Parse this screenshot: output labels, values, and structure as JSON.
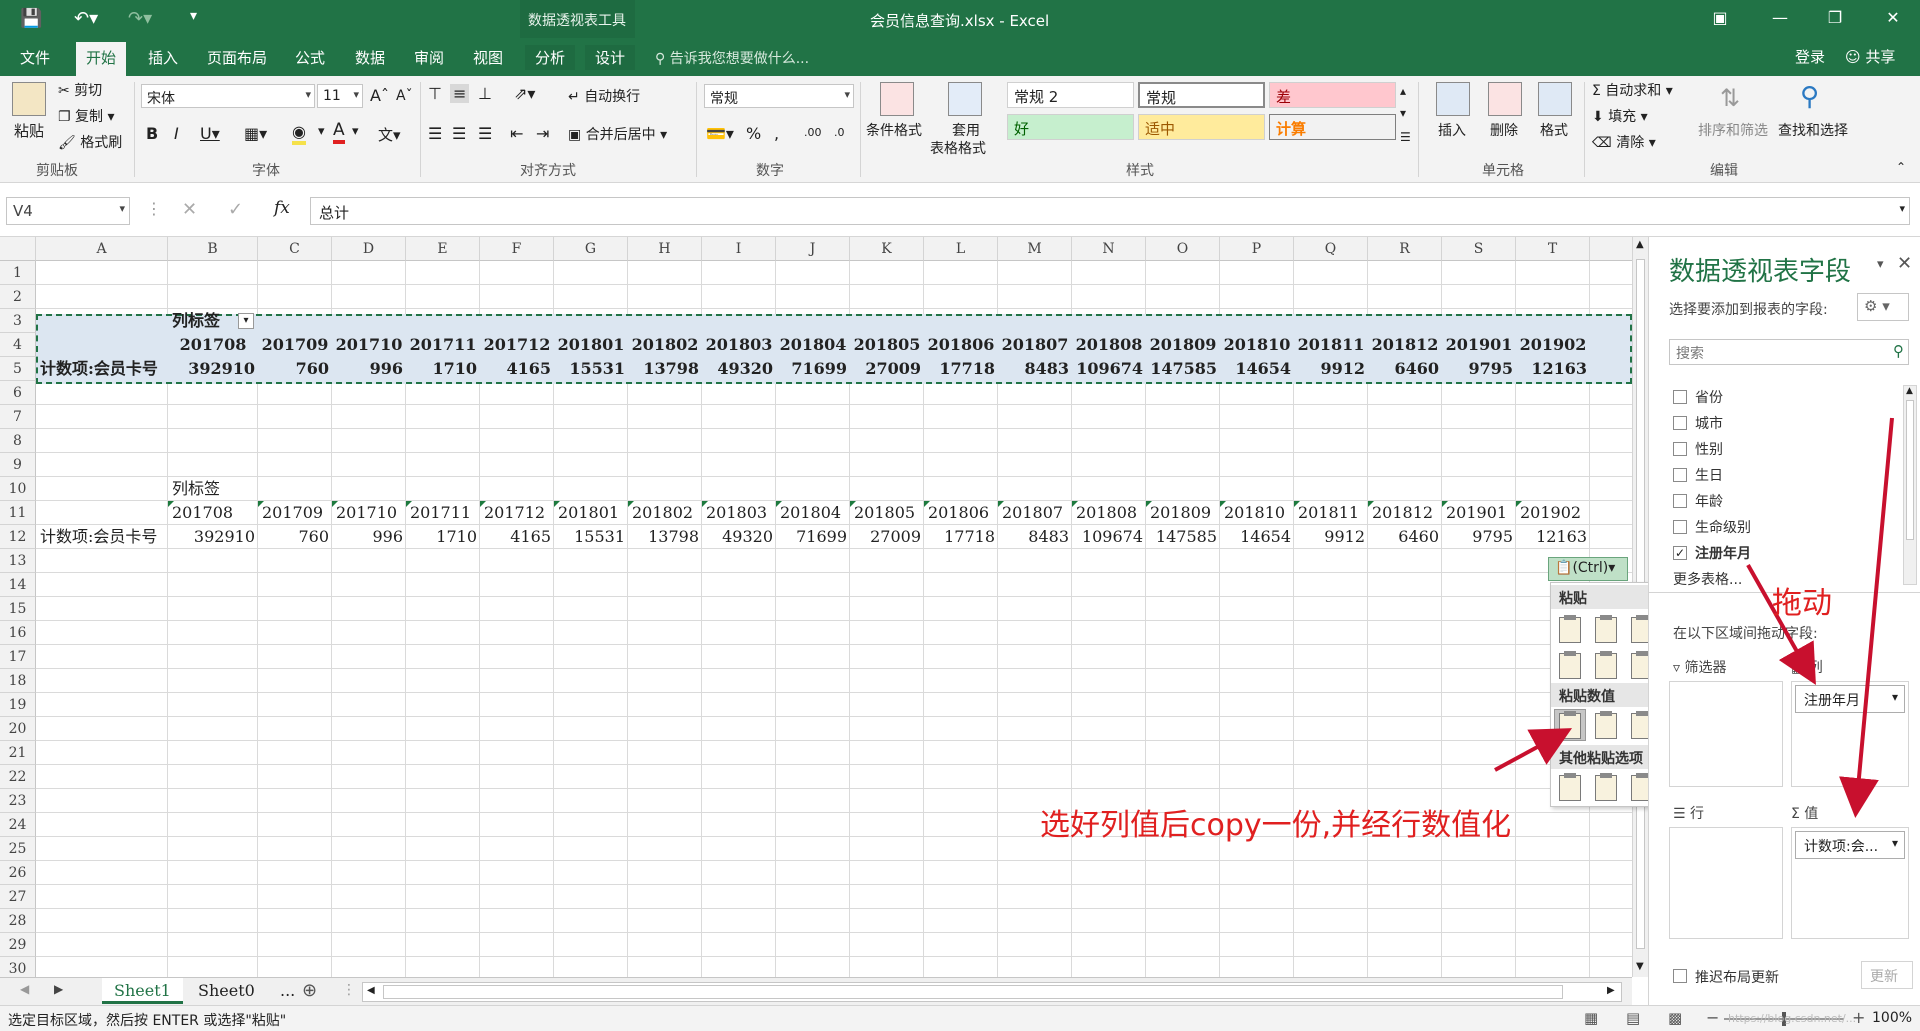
{
  "titlebar": {
    "context_tab_title": "数据透视表工具",
    "window_title": "会员信息查询.xlsx - Excel"
  },
  "tabs": [
    "文件",
    "开始",
    "插入",
    "页面布局",
    "公式",
    "数据",
    "审阅",
    "视图",
    "分析",
    "设计"
  ],
  "tell_me": "告诉我您想要做什么...",
  "account": {
    "login": "登录",
    "share": "共享"
  },
  "ribbon": {
    "clipboard": {
      "paste": "粘贴",
      "cut": "剪切",
      "copy": "复制",
      "format_painter": "格式刷",
      "label": "剪贴板"
    },
    "font": {
      "name": "宋体",
      "size": "11",
      "label": "字体"
    },
    "alignment": {
      "wrap": "自动换行",
      "merge": "合并后居中",
      "label": "对齐方式"
    },
    "number": {
      "format": "常规",
      "label": "数字"
    },
    "styles": {
      "cond_format": "条件格式",
      "table_format_1": "套用",
      "table_format_2": "表格格式",
      "cells": [
        "常规 2",
        "常规",
        "差",
        "好",
        "适中",
        "计算"
      ],
      "label": "样式"
    },
    "cells_group": {
      "insert": "插入",
      "delete": "删除",
      "format": "格式",
      "label": "单元格"
    },
    "editing": {
      "autosum": "自动求和",
      "fill": "填充",
      "clear": "清除",
      "sort": "排序和筛选",
      "find": "查找和选择",
      "label": "编辑"
    }
  },
  "formula_bar": {
    "name_box": "V4",
    "formula": "总计",
    "fx": "fx"
  },
  "grid": {
    "columns": [
      "A",
      "B",
      "C",
      "D",
      "E",
      "F",
      "G",
      "H",
      "I",
      "J",
      "K",
      "L",
      "M",
      "N",
      "O",
      "P",
      "Q",
      "R",
      "S",
      "T"
    ],
    "rows": [
      "1",
      "2",
      "3",
      "4",
      "5",
      "6",
      "7",
      "8",
      "9",
      "10",
      "11",
      "12",
      "13",
      "14",
      "15",
      "16",
      "17",
      "18",
      "19",
      "20",
      "21",
      "22",
      "23",
      "24",
      "25",
      "26",
      "27",
      "28",
      "29",
      "30"
    ],
    "pivot": {
      "col_label": "列标签",
      "row_label": "计数项:会员卡号",
      "headers": [
        "201708",
        "201709",
        "201710",
        "201711",
        "201712",
        "201801",
        "201802",
        "201803",
        "201804",
        "201805",
        "201806",
        "201807",
        "201808",
        "201809",
        "201810",
        "201811",
        "201812",
        "201901",
        "201902"
      ],
      "values": [
        "392910",
        "760",
        "996",
        "1710",
        "4165",
        "15531",
        "13798",
        "49320",
        "71699",
        "27009",
        "17718",
        "8483",
        "109674",
        "147585",
        "14654",
        "9912",
        "6460",
        "9795",
        "12163"
      ]
    },
    "pasted": {
      "col_label": "列标签",
      "row_label": "计数项:会员卡号",
      "headers": [
        "201708",
        "201709",
        "201710",
        "201711",
        "201712",
        "201801",
        "201802",
        "201803",
        "201804",
        "201805",
        "201806",
        "201807",
        "201808",
        "201809",
        "201810",
        "201811",
        "201812",
        "201901",
        "201902"
      ],
      "values": [
        "392910",
        "760",
        "996",
        "1710",
        "4165",
        "15531",
        "13798",
        "49320",
        "71699",
        "27009",
        "17718",
        "8483",
        "109674",
        "147585",
        "14654",
        "9912",
        "6460",
        "9795",
        "12163"
      ]
    }
  },
  "paste_menu": {
    "ctrl": "(Ctrl)",
    "paste": "粘贴",
    "paste_values": "粘贴数值",
    "other": "其他粘贴选项"
  },
  "sheets": [
    "Sheet1",
    "Sheet0",
    "..."
  ],
  "status": {
    "text": "选定目标区域，然后按 ENTER 或选择\"粘贴\"",
    "zoom": "100%",
    "watermark": "https://blog.csdn.net/..."
  },
  "pane": {
    "title": "数据透视表字段",
    "subtitle": "选择要添加到报表的字段:",
    "search_placeholder": "搜索",
    "fields": [
      {
        "name": "省份",
        "checked": false
      },
      {
        "name": "城市",
        "checked": false
      },
      {
        "name": "性别",
        "checked": false
      },
      {
        "name": "生日",
        "checked": false
      },
      {
        "name": "年龄",
        "checked": false
      },
      {
        "name": "生命级别",
        "checked": false
      },
      {
        "name": "注册年月",
        "checked": true
      }
    ],
    "more_tables": "更多表格...",
    "drag_hint": "在以下区域间拖动字段:",
    "filters": "筛选器",
    "columns": "列",
    "rows": "行",
    "values": "值",
    "col_pill": "注册年月",
    "val_pill": "计数项:会...",
    "defer": "推迟布局更新",
    "update": "更新"
  },
  "annotations": {
    "drag": "拖动",
    "copy_note": "选好列值后copy一份,并经行数值化"
  },
  "colors": {
    "excel_green": "#217346",
    "annotation_red": "#e02020",
    "pivot_band": "#dce6f1"
  }
}
